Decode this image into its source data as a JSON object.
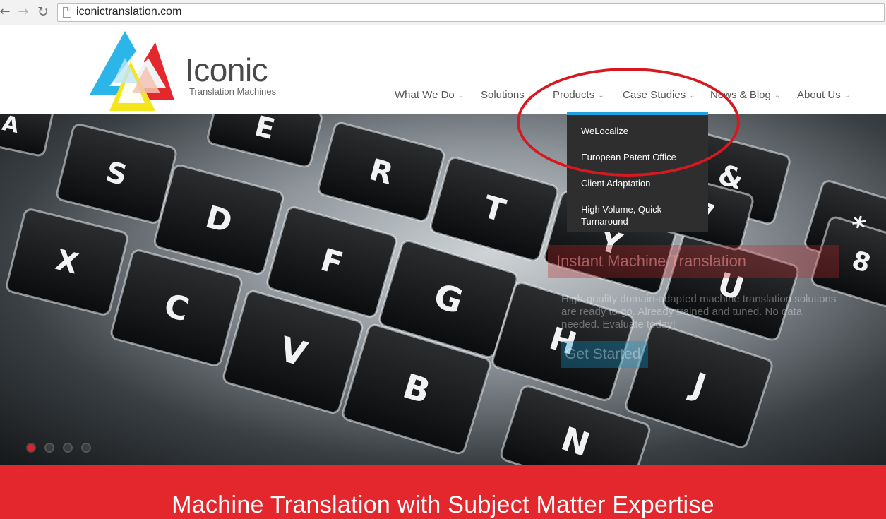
{
  "browser": {
    "url": "iconictranslation.com",
    "back_glyph": "←",
    "forward_glyph": "→",
    "reload_glyph": "↻"
  },
  "logo": {
    "name": "Iconic",
    "tagline": "Translation Machines",
    "colors": {
      "cyan": "#2bb5e8",
      "red": "#e4262d",
      "yellow": "#f4e61a"
    }
  },
  "nav": {
    "items": [
      {
        "label": "What We Do"
      },
      {
        "label": "Solutions"
      },
      {
        "label": "Products"
      },
      {
        "label": "Case Studies"
      },
      {
        "label": "News & Blog"
      },
      {
        "label": "About Us"
      }
    ],
    "chevron": "⌄"
  },
  "dropdown": {
    "items": [
      {
        "label": "WeLocalize"
      },
      {
        "label": "European Patent Office"
      },
      {
        "label": "Client Adaptation"
      },
      {
        "label": "High Volume, Quick Turnaround"
      }
    ],
    "accent": "#1ea1dc"
  },
  "hero": {
    "caption_title": "Instant Machine Translation",
    "caption_text": "High-quality domain-adapted machine translation solutions are ready to go. Already trained and tuned. No data needed. Evaluate today!",
    "cta_label": "Get Started",
    "slide_count": 4,
    "active_slide": 1,
    "keycaps": [
      "A",
      "S",
      "D",
      "F",
      "G",
      "X",
      "C",
      "V",
      "B",
      "E",
      "R",
      "T",
      "H",
      "J",
      "U",
      "Y",
      "N",
      "&",
      "7",
      "*",
      "8"
    ]
  },
  "band": {
    "title": "Machine Translation with Subject Matter Expertise",
    "color": "#e4262d"
  },
  "annotation": {
    "color": "#d7191f"
  }
}
